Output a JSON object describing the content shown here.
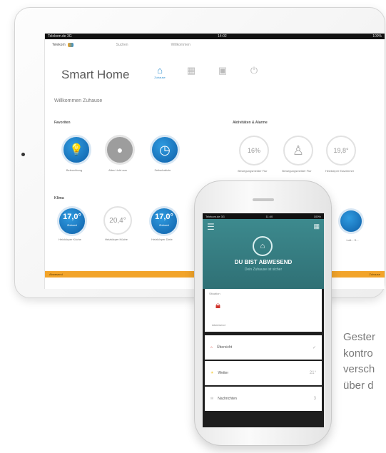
{
  "tablet": {
    "statusbar": {
      "left": "Telekom.de 3G",
      "center": "14:02",
      "right": "100%"
    },
    "brand": "Telekom",
    "search_placeholder": "Suchen",
    "user": "Willkommen",
    "title": "Smart Home",
    "nav": [
      {
        "icon": "house-icon",
        "label": "Zuhause",
        "active": true
      },
      {
        "icon": "graph-icon",
        "label": "",
        "active": false
      },
      {
        "icon": "device-icon",
        "label": "",
        "active": false
      },
      {
        "icon": "plug-icon",
        "label": "",
        "active": false
      }
    ],
    "welcome": "Willkommen Zuhause",
    "sections": {
      "left_top": "Favoriten",
      "right_top": "Aktivitäten & Alarme",
      "left_bottom": "Klima"
    },
    "favorites": [
      {
        "icon": "bulb-icon",
        "label": "Beleuchtung",
        "style": "blue"
      },
      {
        "icon": "bulb-off-icon",
        "label": "Alles Licht aus",
        "style": "grey"
      },
      {
        "icon": "clock-icon",
        "label": "Zeitschaltuhr",
        "style": "blue"
      }
    ],
    "activities": [
      {
        "value": "16%",
        "label": "Bewegungsmelder Flur"
      },
      {
        "icon": "person-icon",
        "label": "Bewegungsmelder Flur"
      },
      {
        "value": "19,8°",
        "label": "Heizkörper Esszimmer"
      }
    ],
    "climate": [
      {
        "value": "17,0°",
        "sub": "Zielwert",
        "label": "Heizkörper Küche",
        "style": "blue"
      },
      {
        "value": "20,4°",
        "sub": "",
        "label": "Heizkörper Küche",
        "style": "ring"
      },
      {
        "value": "17,0°",
        "sub": "Zielwert",
        "label": "Heizkörper Diele",
        "style": "blue"
      }
    ],
    "partial_label": "Luft... S...",
    "footer_left": "Abwesend",
    "footer_right": "Zuhause"
  },
  "phone": {
    "statusbar": {
      "left": "Telekom.de 3G",
      "center": "11:40",
      "right": "100%"
    },
    "hero_title": "DU BIST ABWESEND",
    "hero_subtitle": "Dein Zuhause ist sicher",
    "card_header": "Situation",
    "lock_label": "Abwesend",
    "rows": [
      {
        "icon": "house-icon",
        "label": "Übersicht",
        "badge": "✓"
      },
      {
        "icon": "sun-icon",
        "label": "Wetter",
        "badge": "21°"
      },
      {
        "icon": "message-icon",
        "label": "Nachrichten",
        "badge": "3"
      }
    ]
  },
  "side_text": [
    "Gester",
    "kontro",
    "versch",
    "über d"
  ],
  "colors": {
    "accent_blue": "#2d8ecf",
    "teal": "#3d8a8e",
    "orange": "#f2a42a",
    "alarm_red": "#d0342c"
  }
}
